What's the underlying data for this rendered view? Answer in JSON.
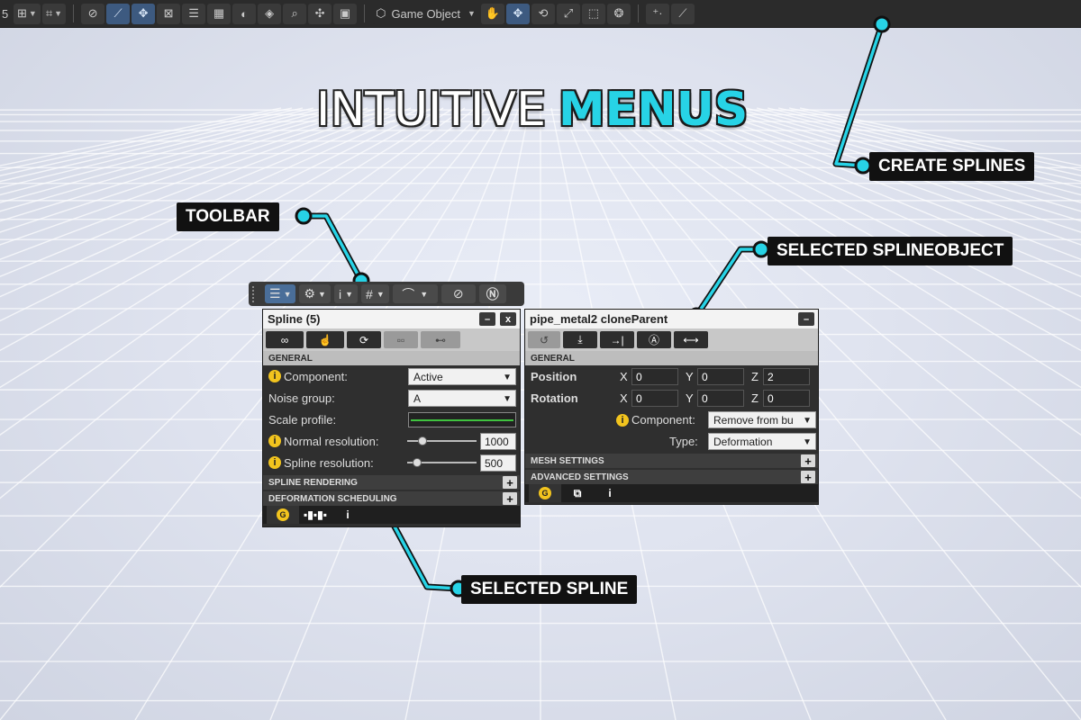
{
  "headline": {
    "word1": "INTUITIVE",
    "word2": "MENUS"
  },
  "callouts": {
    "create_splines": "CREATE SPLINES",
    "toolbar": "TOOLBAR",
    "selected_splineobject": "SELECTED SPLINEOBJECT",
    "selected_spline": "SELECTED SPLINE"
  },
  "top_toolbar": {
    "number_prefix": "5",
    "game_object_label": "Game Object"
  },
  "colors": {
    "accent": "#27d3e6",
    "panel_bg": "#2f2f2f",
    "toolbar_bg": "#2b2b2b",
    "active_blue": "#3d5a80",
    "info_yellow": "#f2c41e"
  },
  "spline_panel": {
    "title": "Spline (5)",
    "minimize_label": "–",
    "close_label": "x",
    "section_general": "GENERAL",
    "component_label": "Component:",
    "component_value": "Active",
    "noise_group_label": "Noise group:",
    "noise_group_value": "A",
    "scale_profile_label": "Scale profile:",
    "normal_resolution_label": "Normal resolution:",
    "normal_resolution_value": "1000",
    "spline_resolution_label": "Spline resolution:",
    "spline_resolution_value": "500",
    "section_spline_rendering": "SPLINE RENDERING",
    "section_deformation_scheduling": "DEFORMATION SCHEDULING",
    "plus_label": "+",
    "footer_badge": "G",
    "footer_info": "i"
  },
  "object_panel": {
    "title": "pipe_metal2 cloneParent",
    "minimize_label": "–",
    "section_general": "GENERAL",
    "position_label": "Position",
    "rotation_label": "Rotation",
    "x_label": "X",
    "y_label": "Y",
    "z_label": "Z",
    "position": {
      "x": "0",
      "y": "0",
      "z": "2"
    },
    "rotation": {
      "x": "0",
      "y": "0",
      "z": "0"
    },
    "component_label": "Component:",
    "component_value": "Remove from bu",
    "type_label": "Type:",
    "type_value": "Deformation",
    "section_mesh_settings": "MESH SETTINGS",
    "section_advanced_settings": "ADVANCED SETTINGS",
    "plus_label": "+",
    "footer_badge": "G",
    "footer_info": "i"
  },
  "icons": {
    "toolbar_menu": "menu-icon",
    "toolbar_gear": "gear-icon",
    "toolbar_info": "info-icon",
    "toolbar_grid": "grid-icon",
    "toolbar_curve": "curve-icon",
    "toolbar_hide": "eye-off-icon",
    "toolbar_n": "n-logo-icon"
  }
}
